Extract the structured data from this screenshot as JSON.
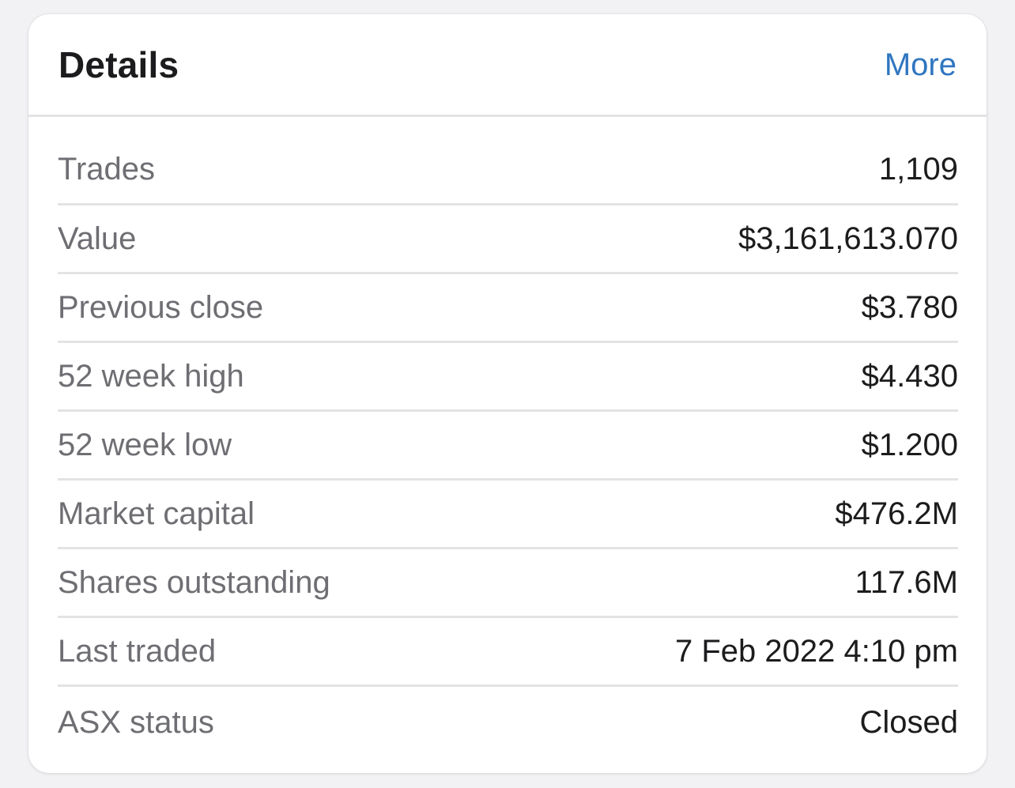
{
  "header": {
    "title": "Details",
    "more_label": "More"
  },
  "rows": [
    {
      "label": "Trades",
      "value": "1,109"
    },
    {
      "label": "Value",
      "value": "$3,161,613.070"
    },
    {
      "label": "Previous close",
      "value": "$3.780"
    },
    {
      "label": "52 week high",
      "value": "$4.430"
    },
    {
      "label": "52 week low",
      "value": "$1.200"
    },
    {
      "label": "Market capital",
      "value": "$476.2M"
    },
    {
      "label": "Shares outstanding",
      "value": "117.6M"
    },
    {
      "label": "Last traded",
      "value": "7 Feb 2022 4:10 pm"
    },
    {
      "label": "ASX status",
      "value": "Closed"
    }
  ],
  "colors": {
    "accent": "#2f76c0",
    "label_gray": "#6e6e73",
    "value_dark": "#1c1c1e",
    "divider": "#e3e3e6",
    "background": "#f2f2f4"
  }
}
